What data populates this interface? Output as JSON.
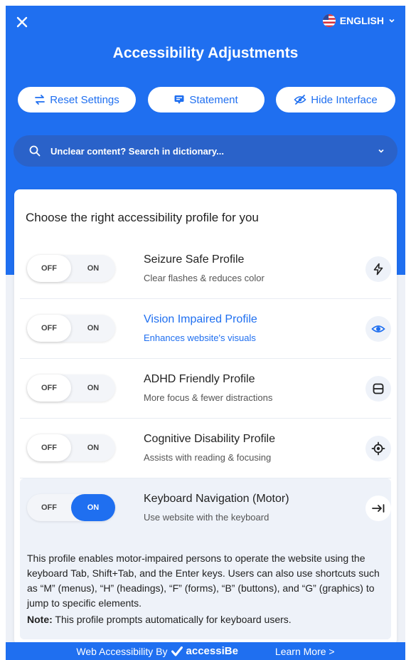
{
  "header": {
    "language": "ENGLISH",
    "title": "Accessibility Adjustments",
    "buttons": {
      "reset": "Reset Settings",
      "statement": "Statement",
      "hide": "Hide Interface"
    },
    "search": {
      "placeholder": "Unclear content? Search in dictionary..."
    }
  },
  "card": {
    "title": "Choose the right accessibility profile for you",
    "toggle_off": "OFF",
    "toggle_on": "ON",
    "profiles": [
      {
        "name": "Seizure Safe Profile",
        "desc": "Clear flashes & reduces color",
        "icon": "bolt-icon",
        "state": "off"
      },
      {
        "name": "Vision Impaired Profile",
        "desc": "Enhances website's visuals",
        "icon": "eye-icon",
        "state": "off"
      },
      {
        "name": "ADHD Friendly Profile",
        "desc": "More focus & fewer distractions",
        "icon": "focus-frame-icon",
        "state": "off"
      },
      {
        "name": "Cognitive Disability Profile",
        "desc": "Assists with reading & focusing",
        "icon": "target-icon",
        "state": "off"
      },
      {
        "name": "Keyboard Navigation (Motor)",
        "desc": "Use website with the keyboard",
        "icon": "tab-arrow-icon",
        "state": "on",
        "body": "This profile enables motor-impaired persons to operate the website using the keyboard Tab, Shift+Tab, and the Enter keys. Users can also use shortcuts such as “M” (menus), “H” (headings), “F” (forms), “B” (buttons), and “G” (graphics) to jump to specific elements.",
        "note_label": "Note:",
        "note_text": " This profile prompts automatically for keyboard users."
      }
    ]
  },
  "footer": {
    "by": "Web Accessibility By",
    "brand": "accessiBe",
    "learn_more": "Learn More >"
  },
  "colors": {
    "accent": "#1f6ff0",
    "search_bg": "#2a62c9"
  }
}
